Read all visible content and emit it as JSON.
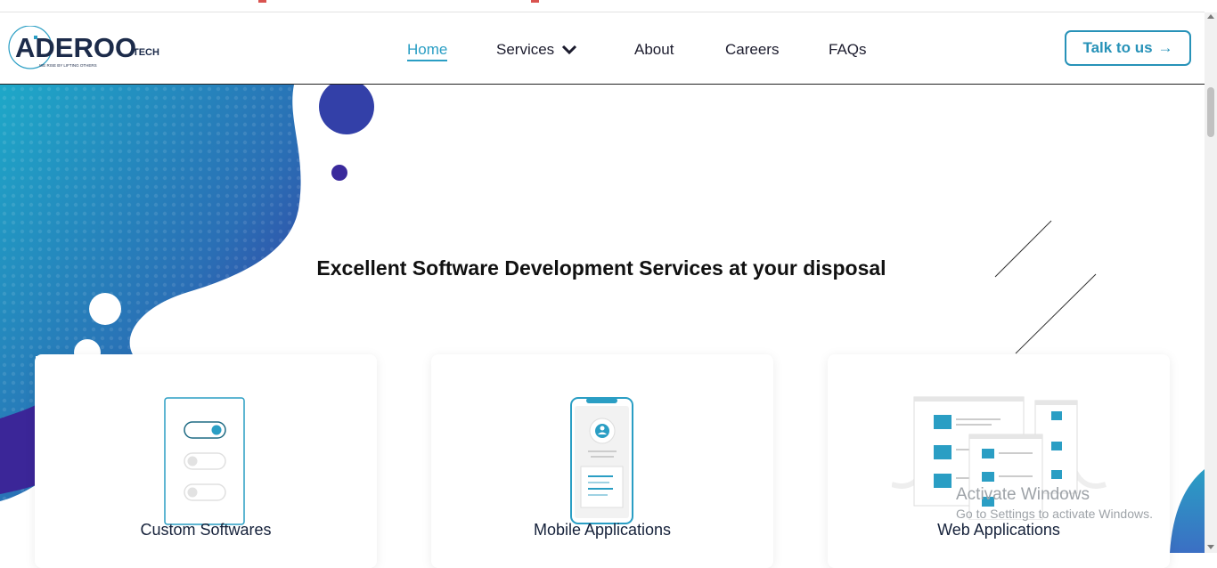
{
  "header": {
    "logo_text": "ADEROO",
    "logo_suffix": "TECH",
    "logo_tagline": "WE RISE BY LIFTING OTHERS",
    "nav": {
      "home": "Home",
      "services": "Services",
      "about": "About",
      "careers": "Careers",
      "faqs": "FAQs"
    },
    "cta_label": "Talk to us",
    "cta_arrow": "→"
  },
  "hero": {
    "headline": "Excellent Software Development Services at your disposal"
  },
  "services": [
    {
      "title": "Custom Softwares",
      "icon": "toggle-switches-icon"
    },
    {
      "title": "Mobile Applications",
      "icon": "mobile-phone-icon"
    },
    {
      "title": "Web Applications",
      "icon": "browser-windows-icon"
    }
  ],
  "watermark": {
    "line1": "Activate Windows",
    "line2": "Go to Settings to activate Windows."
  },
  "colors": {
    "accent": "#2a9ec4",
    "brand_dark": "#1c2b4a",
    "blob_start": "#1fa6c7",
    "blob_end": "#3a2aa0"
  }
}
